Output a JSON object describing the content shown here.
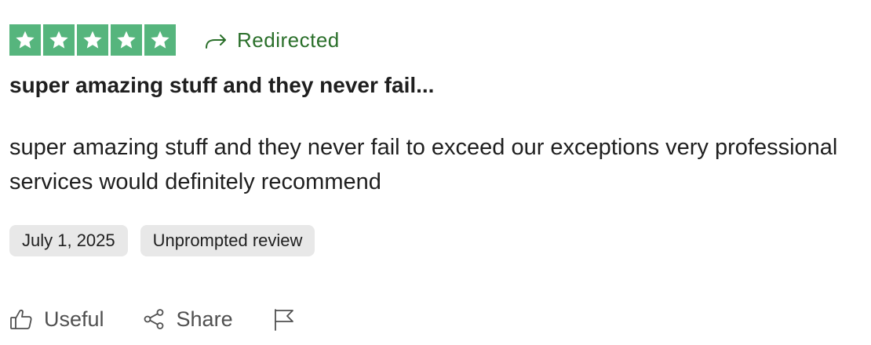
{
  "review": {
    "rating": 5,
    "rating_max": 5,
    "redirect_label": "Redirected",
    "title": "super amazing stuff and they never fail...",
    "body": "super amazing stuff and they never fail to exceed our exceptions very professional services would definitely recommend",
    "date": "July 1, 2025",
    "source_badge": "Unprompted review"
  },
  "actions": {
    "useful_label": "Useful",
    "share_label": "Share"
  },
  "colors": {
    "star_fill": "#56b57d",
    "redirect_text": "#2a6f2a",
    "chip_bg": "#e8e8e8",
    "text_primary": "#1f1f1f",
    "text_secondary": "#505050"
  },
  "icons": {
    "star": "star-icon",
    "redirect": "redirect-arrow-icon",
    "useful": "thumbs-up-icon",
    "share": "share-icon",
    "flag": "flag-icon"
  }
}
